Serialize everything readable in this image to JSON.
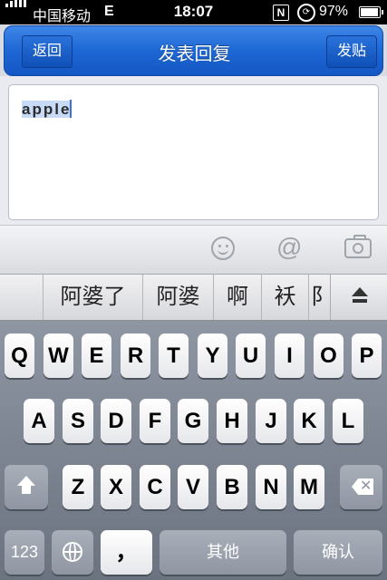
{
  "status_bar": {
    "carrier": "中国移动",
    "network": "E",
    "time": "18:07",
    "battery": "97%",
    "battery_level": 0.97,
    "icons": [
      "signal-icon",
      "nfc-n-icon",
      "orientation-lock-icon",
      "battery-icon"
    ]
  },
  "nav": {
    "back_label": "返回",
    "title": "发表回复",
    "post_label": "发贴"
  },
  "editor": {
    "text": "apple"
  },
  "toolbar": {
    "icons": [
      "emoji-icon",
      "mention-at-icon",
      "camera-icon"
    ],
    "at_glyph": "@"
  },
  "candidates": {
    "apple_glyph": "",
    "items": [
      "阿婆了",
      "阿婆",
      "啊",
      "袄",
      "阝"
    ]
  },
  "keyboard": {
    "row1": [
      "Q",
      "W",
      "E",
      "R",
      "T",
      "Y",
      "U",
      "I",
      "O",
      "P"
    ],
    "row2": [
      "A",
      "S",
      "D",
      "F",
      "G",
      "H",
      "J",
      "K",
      "L"
    ],
    "row3": [
      "Z",
      "X",
      "C",
      "V",
      "B",
      "N",
      "M"
    ],
    "numbers_label": "123",
    "comma_label": "，",
    "space_label": "其他",
    "confirm_label": "确认"
  }
}
